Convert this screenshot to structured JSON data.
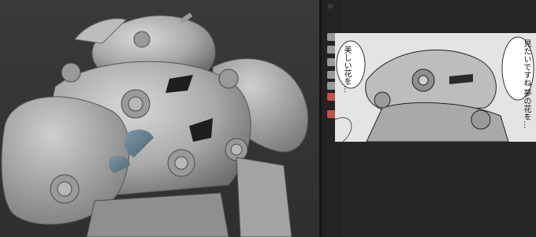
{
  "app": {
    "panels": {
      "viewport": {
        "subject": "3D sculpt: armored round robot (grey clay)"
      },
      "reference": {
        "subject": "manga reference panel",
        "speech_left": "美しい花を…",
        "speech_right": "見たいですね 夢の花を…"
      }
    },
    "toolstrip": {
      "icons": [
        "select-icon",
        "move-icon",
        "paint-icon",
        "brush-icon",
        "layer-icon",
        "record-icon",
        "target-icon"
      ]
    }
  }
}
